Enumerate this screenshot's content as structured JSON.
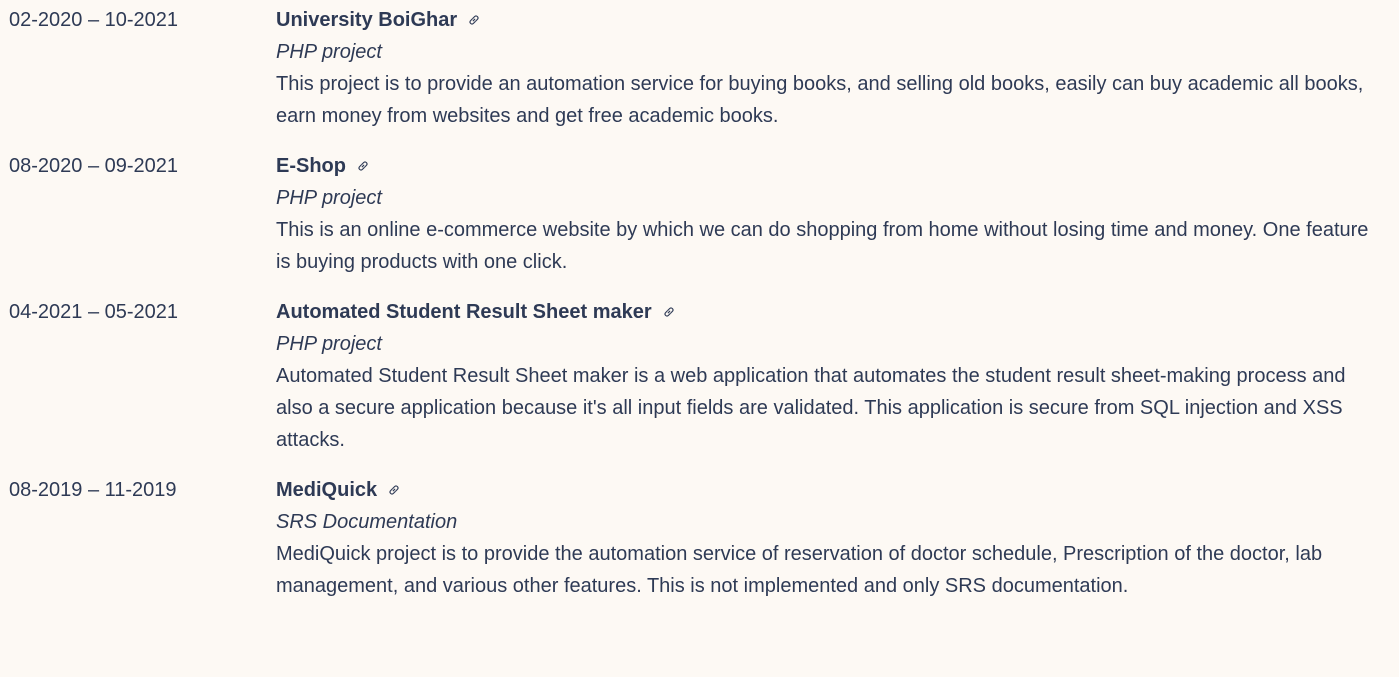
{
  "icon": "link-icon",
  "colors": {
    "background": "#fdf9f4",
    "text": "#2e3a55"
  },
  "projects": [
    {
      "period": "02-2020 – 10-2021",
      "title": "University BoiGhar",
      "subtitle": "PHP project",
      "description": "This project is to provide an automation service for buying books, and selling old books, easily can buy academic all books, earn money from websites and get free academic books."
    },
    {
      "period": "08-2020 – 09-2021",
      "title": "E-Shop",
      "subtitle": "PHP project",
      "description": "This is an online e-commerce website by which we can do shopping from home without losing time and money. One feature is buying products with one click."
    },
    {
      "period": "04-2021 – 05-2021",
      "title": "Automated Student Result Sheet maker",
      "subtitle": "PHP project",
      "description": "Automated Student Result Sheet maker is a web application that automates the student result sheet-making process and also a secure application because it's all input fields are validated. This application is secure from SQL injection and XSS attacks."
    },
    {
      "period": "08-2019 – 11-2019",
      "title": "MediQuick",
      "subtitle": "SRS Documentation",
      "description": "MediQuick project is to provide the automation service of reservation of doctor schedule, Prescription of the doctor, lab management, and various other features. This is not implemented and only SRS documentation."
    }
  ]
}
